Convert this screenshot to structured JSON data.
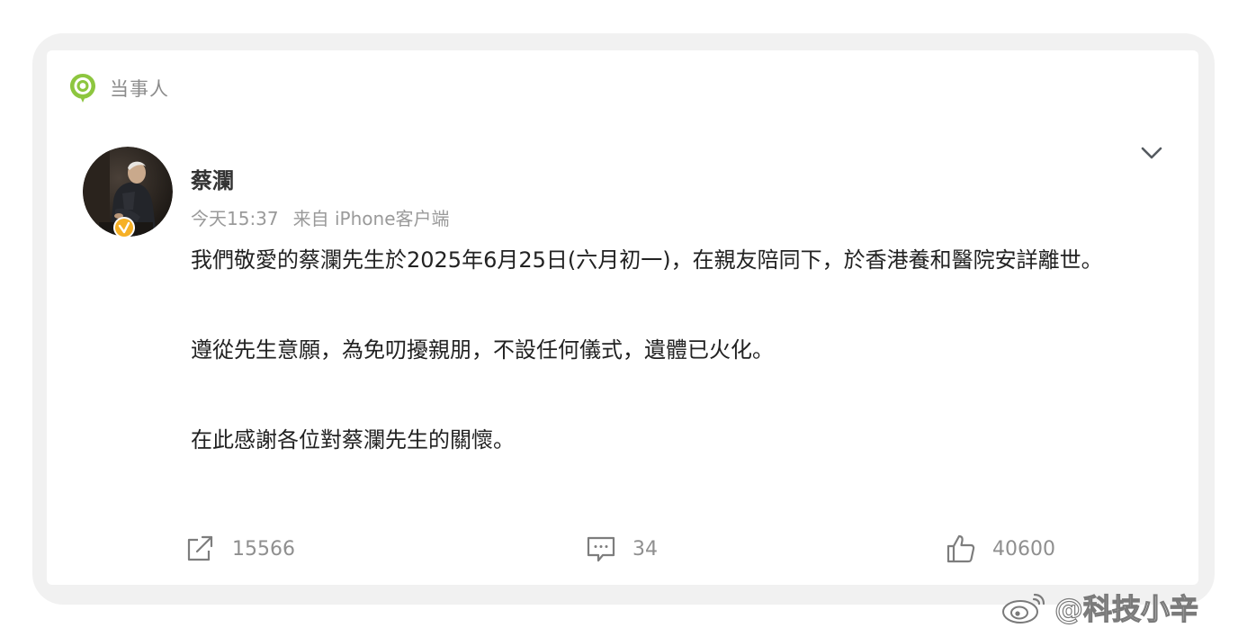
{
  "topic": {
    "label": "当事人",
    "icon": "topic-bubble-icon"
  },
  "post": {
    "author": "蔡瀾",
    "time": "今天15:37",
    "source": "来自 iPhone客户端",
    "paragraphs": [
      "我們敬愛的蔡瀾先生於2025年6月25日(六月初一)，在親友陪同下，於香港養和醫院安詳離世。",
      "遵從先生意願，為免叨擾親朋，不設任何儀式，遺體已火化。",
      "在此感謝各位對蔡瀾先生的關懷。"
    ]
  },
  "actions": {
    "share_count": "15566",
    "comment_count": "34",
    "like_count": "40600"
  },
  "watermark": {
    "text": "@科技小辛"
  },
  "colors": {
    "accent_green": "#8dc63f",
    "verified_gold": "#f6b026",
    "text_muted": "#8f8f8f"
  }
}
